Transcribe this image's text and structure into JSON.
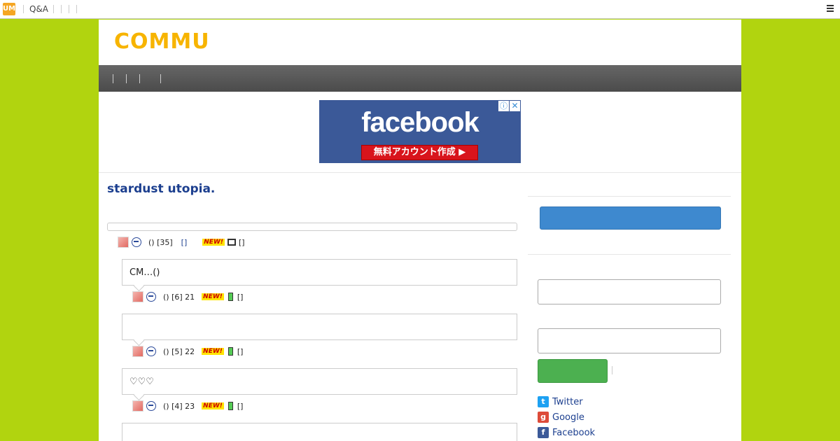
{
  "topbar": {
    "logo": "UM",
    "qa_link": "Q&A"
  },
  "brand": {
    "name": "COMMU"
  },
  "ad": {
    "headline": "facebook",
    "button": "無料アカウント作成 ▶",
    "info": "ⓘ",
    "close": "✕",
    "colors": {
      "background": "#3b5998",
      "button": "#d8141c"
    }
  },
  "thread": {
    "title": "stardust utopia.",
    "root": {
      "meta": "() [35]",
      "link": "[]",
      "new_label": "NEW!",
      "device_icon": "pc-icon",
      "bracket": "[]"
    },
    "replies": [
      {
        "body": "CM…()",
        "meta": "() [6] 21",
        "new_label": "NEW!",
        "device_icon": "phone-icon",
        "bracket": "[]"
      },
      {
        "body": "",
        "meta": "() [5] 22",
        "new_label": "NEW!",
        "device_icon": "phone-icon",
        "bracket": "[]"
      },
      {
        "body": "♡♡♡",
        "meta": "() [4] 23",
        "new_label": "NEW!",
        "device_icon": "phone-icon",
        "bracket": "[]"
      },
      {
        "body": ""
      }
    ]
  },
  "sidebar": {
    "login_options": [
      {
        "label": "Twitter",
        "icon": "twitter-icon",
        "color": "#1da1f2"
      },
      {
        "label": "Google",
        "icon": "google-icon",
        "color": "#dd4b39"
      },
      {
        "label": "Facebook",
        "icon": "facebook-icon",
        "color": "#3b5998"
      }
    ]
  },
  "colors": {
    "page_background": "#b1d40f",
    "brand": "#f7b400",
    "title": "#1c3f8f",
    "primary_button": "#3e89cf",
    "login_button": "#4cb050"
  }
}
